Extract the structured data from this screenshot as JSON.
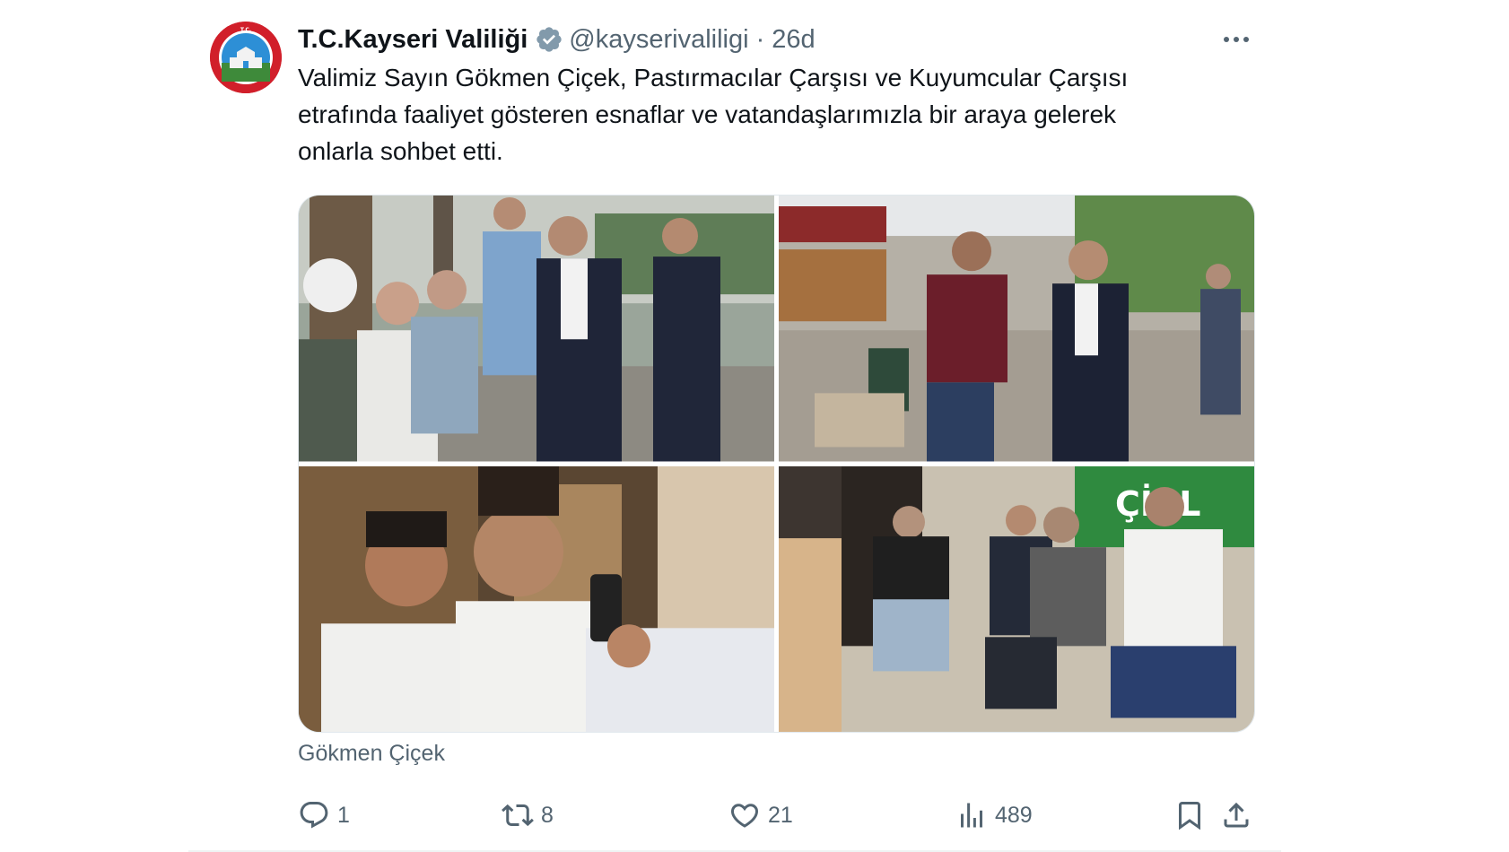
{
  "account": {
    "display_name": "T.C.Kayseri Valiliği",
    "handle": "@kayserivaliligi",
    "separator": "·",
    "time": "26d",
    "verified_icon": "verified-badge-icon",
    "avatar_logo_text": "T.C. KAYSERİ VALİLİĞİ"
  },
  "tweet": {
    "lines": [
      "Valimiz Sayın Gökmen Çiçek, Pastırmacılar Çarşısı ve Kuyumcular Çarşısı",
      "etrafında faaliyet gösteren esnaflar ve vatandaşlarımızla bir araya gelerek",
      "onlarla sohbet etti."
    ],
    "media_count": 4,
    "caption": "Gökmen Çiçek"
  },
  "photo_sign_text": "ÇİRL",
  "actions": {
    "reply": {
      "icon": "reply-icon",
      "count": "1"
    },
    "retweet": {
      "icon": "retweet-icon",
      "count": "8"
    },
    "like": {
      "icon": "heart-icon",
      "count": "21"
    },
    "views": {
      "icon": "views-chart-icon",
      "count": "489"
    },
    "bookmark": {
      "icon": "bookmark-icon"
    },
    "share": {
      "icon": "share-icon"
    }
  },
  "colors": {
    "text_primary": "#0f1419",
    "text_secondary": "#536471",
    "verified_blue": "#829aab",
    "avatar_red": "#d11f2a"
  }
}
